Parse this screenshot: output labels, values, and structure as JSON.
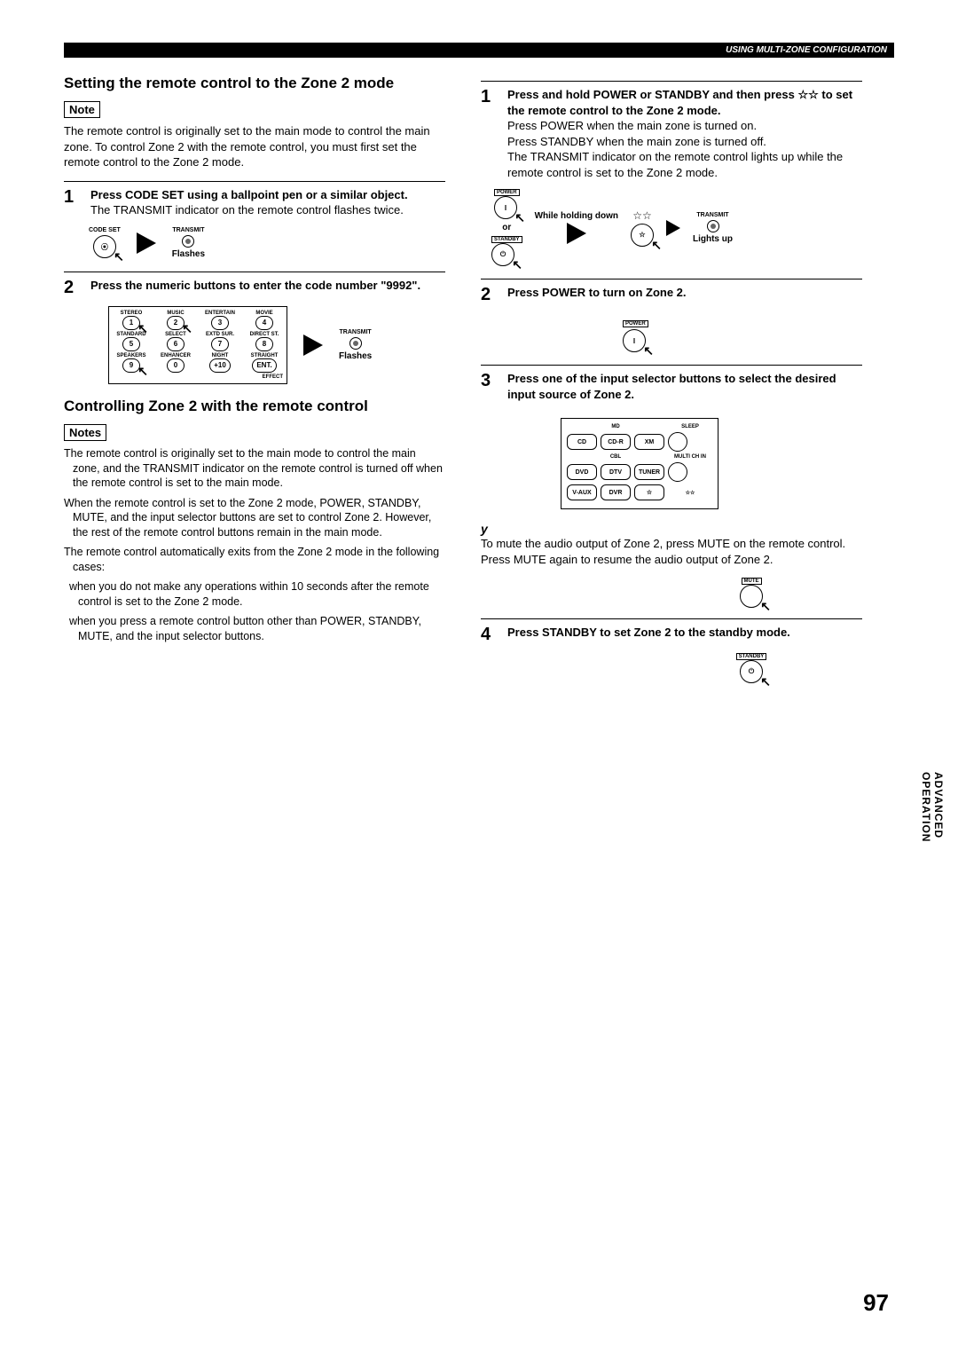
{
  "header": {
    "banner": "USING MULTI-ZONE CONFIGURATION"
  },
  "sideTab": {
    "line1": "ADVANCED",
    "line2": "OPERATION"
  },
  "pageNumber": "97",
  "left": {
    "title1": "Setting the remote control to the Zone 2 mode",
    "noteLabel": "Note",
    "noteText": "The remote control is originally set to the main mode to control the main zone. To control Zone 2 with the remote control, you must first set the remote control to the Zone 2 mode.",
    "step1": {
      "bold": "Press CODE SET using a ballpoint pen or a similar object.",
      "text": "The TRANSMIT indicator on the remote control flashes twice.",
      "codesetLabel": "CODE SET",
      "transmitLabel": "TRANSMIT",
      "flashesLabel": "Flashes"
    },
    "step2": {
      "bold": "Press the numeric buttons to enter the code number \"9992\".",
      "flashesLabel": "Flashes",
      "transmitLabel": "TRANSMIT",
      "row1labels": [
        "STEREO",
        "MUSIC",
        "ENTERTAIN",
        "MOVIE"
      ],
      "row1nums": [
        "1",
        "2",
        "3",
        "4"
      ],
      "row2labels": [
        "STANDARD",
        "SELECT",
        "EXTD SUR.",
        "DIRECT ST."
      ],
      "row2nums": [
        "5",
        "6",
        "7",
        "8"
      ],
      "row3labels": [
        "SPEAKERS",
        "ENHANCER",
        "NIGHT",
        "STRAIGHT"
      ],
      "row3nums": [
        "9",
        "0",
        "+10",
        "ENT."
      ],
      "effectLabel": "EFFECT"
    },
    "title2": "Controlling Zone 2 with the remote control",
    "notesLabel": "Notes",
    "bullet1": "The remote control is originally set to the main mode to control the main zone, and the TRANSMIT indicator on the remote control is turned off when the remote control is set to the main mode.",
    "bullet2": "When the remote control is set to the Zone 2 mode, POWER, STANDBY, MUTE, and the input selector buttons are set to control Zone 2. However, the rest of the remote control buttons remain in the main mode.",
    "bullet3": "The remote control automatically exits from the Zone 2 mode in the following cases:",
    "bullet3a": "when you do not make any operations within 10 seconds after the remote control is set to the Zone 2 mode.",
    "bullet3b": "when you press a remote control button other than POWER, STANDBY, MUTE, and the input selector buttons."
  },
  "right": {
    "step1": {
      "bold": "Press and hold POWER or STANDBY and then press ☆☆ to set the remote control to the Zone 2 mode.",
      "line1": "Press POWER when the main zone is turned on.",
      "line2": "Press STANDBY when the main zone is turned off.",
      "line3": "The TRANSMIT indicator on the remote control lights up while the remote control is set to the Zone 2 mode.",
      "powerLabel": "POWER",
      "standbyLabel": "STANDBY",
      "holdLabel": "While holding down",
      "orLabel": "or",
      "starLabel": "☆☆",
      "transmitLabel": "TRANSMIT",
      "lightsLabel": "Lights up"
    },
    "step2": {
      "bold": "Press POWER to turn on Zone 2.",
      "powerLabel": "POWER"
    },
    "step3": {
      "bold": "Press one of the input selector buttons to select the desired input source of Zone 2.",
      "row1": [
        "",
        "MD",
        "",
        ""
      ],
      "row1b": [
        "CD",
        "CD-R",
        "XM",
        ""
      ],
      "row1right": "SLEEP",
      "row2top": [
        "",
        "CBL",
        "",
        ""
      ],
      "row2": [
        "DVD",
        "DTV",
        "TUNER",
        ""
      ],
      "row2right": "MULTI CH IN",
      "row3": [
        "V-AUX",
        "DVR",
        "☆",
        ""
      ],
      "row3rightGlyph": "☆☆"
    },
    "yLabel": "y",
    "yText": "To mute the audio output of Zone 2, press MUTE on the remote control. Press MUTE again to resume the audio output of Zone 2.",
    "muteLabel": "MUTE",
    "step4": {
      "bold": "Press STANDBY to set Zone 2 to the standby mode.",
      "standbyLabel": "STANDBY"
    }
  }
}
